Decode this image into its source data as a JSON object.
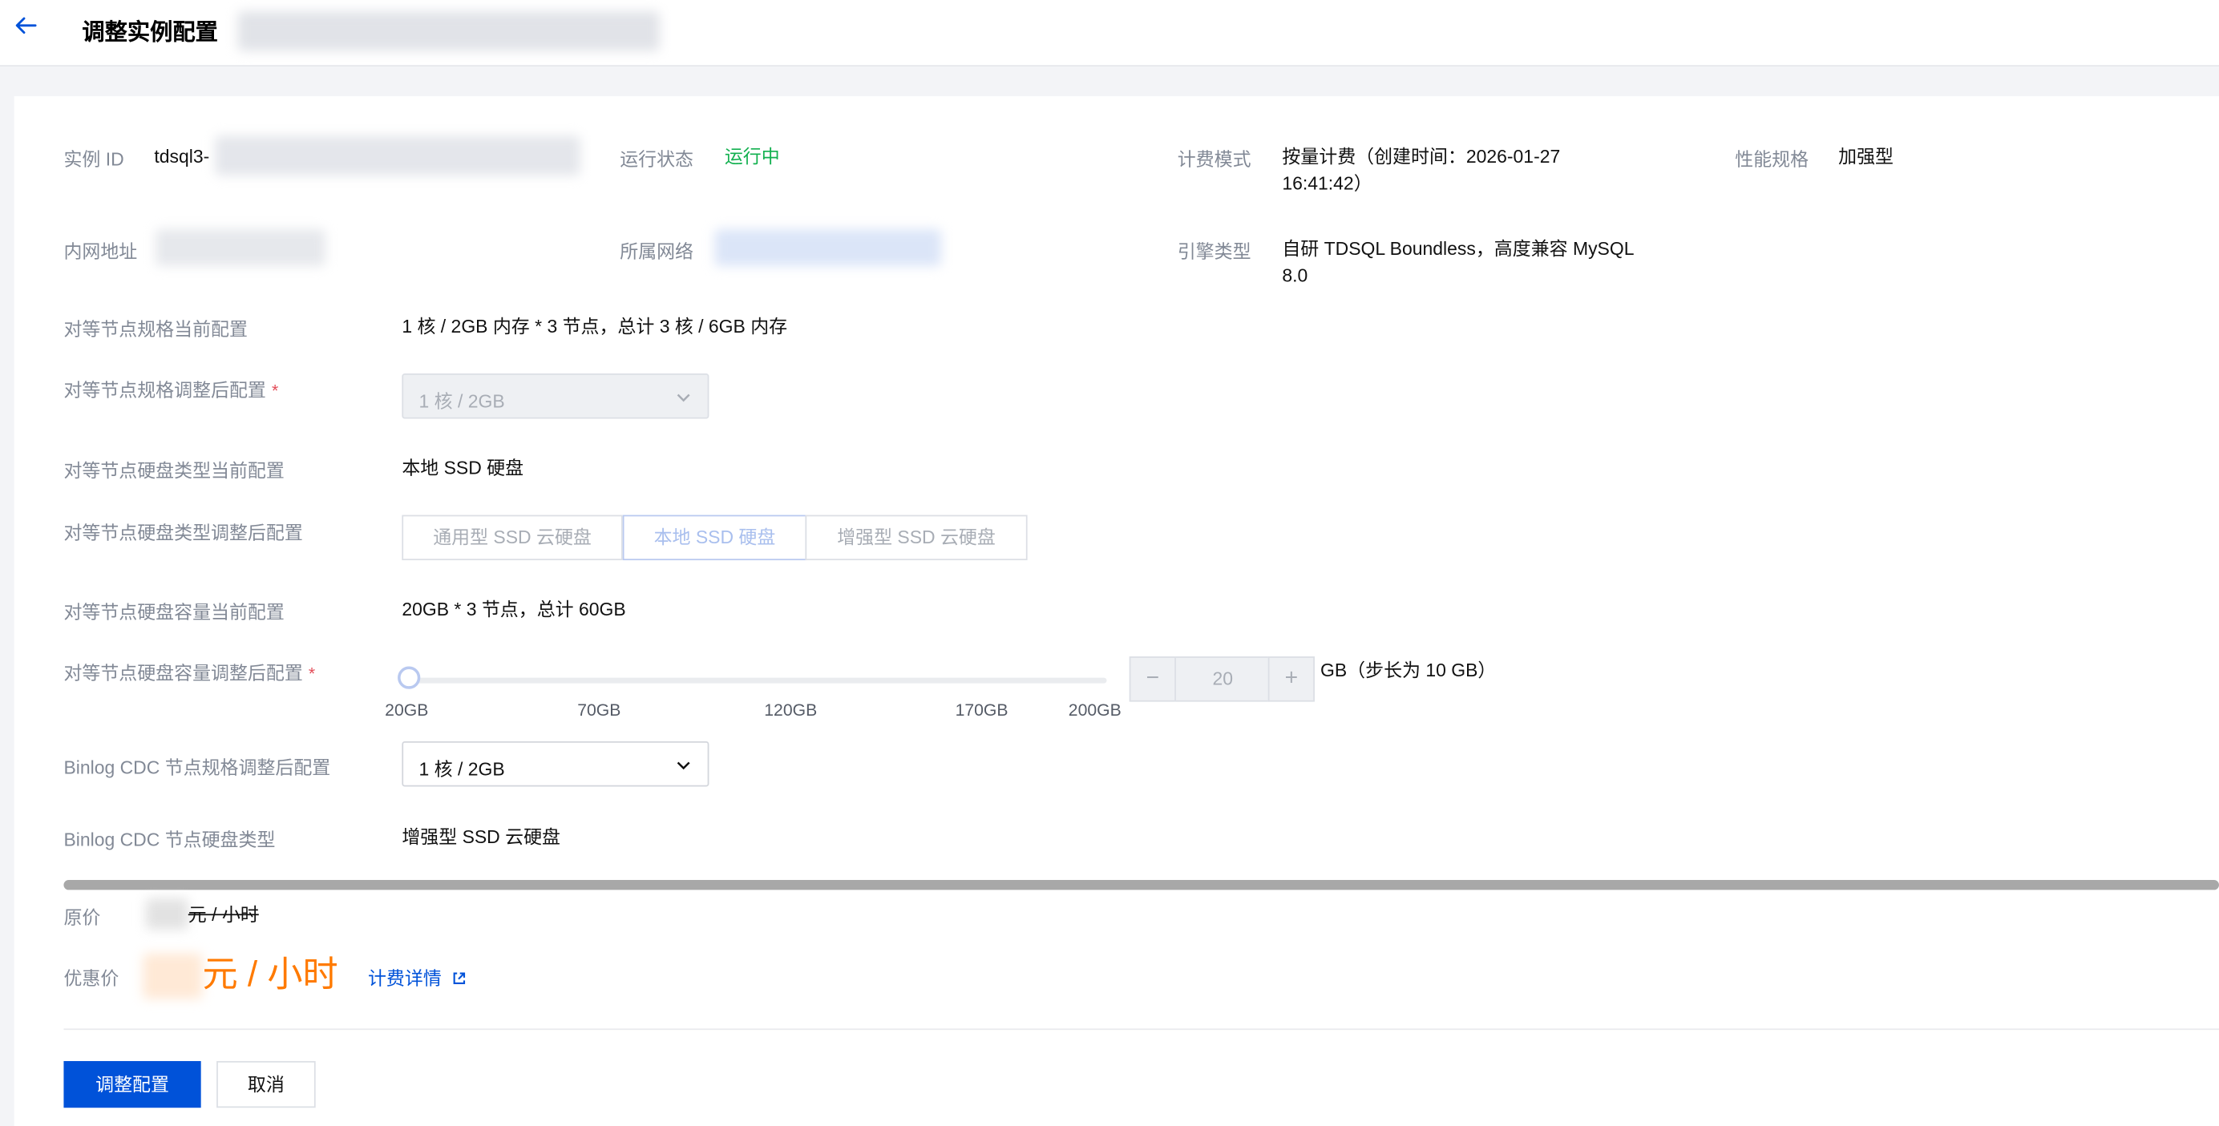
{
  "header": {
    "title": "调整实例配置"
  },
  "info": {
    "instance_id_label": "实例 ID",
    "instance_id_value": "tdsql3-",
    "run_status_label": "运行状态",
    "run_status_value": "运行中",
    "billing_mode_label": "计费模式",
    "billing_mode_value_line1": "按量计费（创建时间：2026-01-27",
    "billing_mode_value_line2": "16:41:42）",
    "perf_spec_label": "性能规格",
    "perf_spec_value": "加强型",
    "private_ip_label": "内网地址",
    "network_label": "所属网络",
    "engine_label": "引擎类型",
    "engine_value_line1": "自研 TDSQL Boundless，高度兼容 MySQL",
    "engine_value_line2": "8.0"
  },
  "form": {
    "peer_spec_current_label": "对等节点规格当前配置",
    "peer_spec_current_value": "1 核 / 2GB 内存 * 3 节点，总计 3 核 / 6GB 内存",
    "peer_spec_new_label": "对等节点规格调整后配置",
    "peer_spec_new_value": "1 核 / 2GB",
    "disk_type_current_label": "对等节点硬盘类型当前配置",
    "disk_type_current_value": "本地 SSD 硬盘",
    "disk_type_new_label": "对等节点硬盘类型调整后配置",
    "disk_type_options": [
      "通用型 SSD 云硬盘",
      "本地 SSD 硬盘",
      "增强型 SSD 云硬盘"
    ],
    "disk_cap_current_label": "对等节点硬盘容量当前配置",
    "disk_cap_current_value": "20GB * 3 节点，总计 60GB",
    "disk_cap_new_label": "对等节点硬盘容量调整后配置",
    "slider_ticks": [
      "20GB",
      "70GB",
      "120GB",
      "170GB",
      "200GB"
    ],
    "slider_value_fraction": 0,
    "stepper_minus": "−",
    "stepper_value": "20",
    "stepper_plus": "+",
    "stepper_unit": "GB（步长为 10 GB）",
    "cdc_spec_label": "Binlog CDC 节点规格调整后配置",
    "cdc_spec_value": "1 核 / 2GB",
    "cdc_disk_label": "Binlog CDC 节点硬盘类型",
    "cdc_disk_value": "增强型 SSD 云硬盘",
    "required_mark": "*"
  },
  "price": {
    "original_label": "原价",
    "original_unit": "元 / 小时",
    "discount_label": "优惠价",
    "discount_unit": "元 / 小时",
    "details_link": "计费详情"
  },
  "actions": {
    "confirm": "调整配置",
    "cancel": "取消"
  },
  "colors": {
    "primary": "#0052d9",
    "success": "#12b04f",
    "price": "#ff7a00",
    "required": "#e34d59"
  }
}
